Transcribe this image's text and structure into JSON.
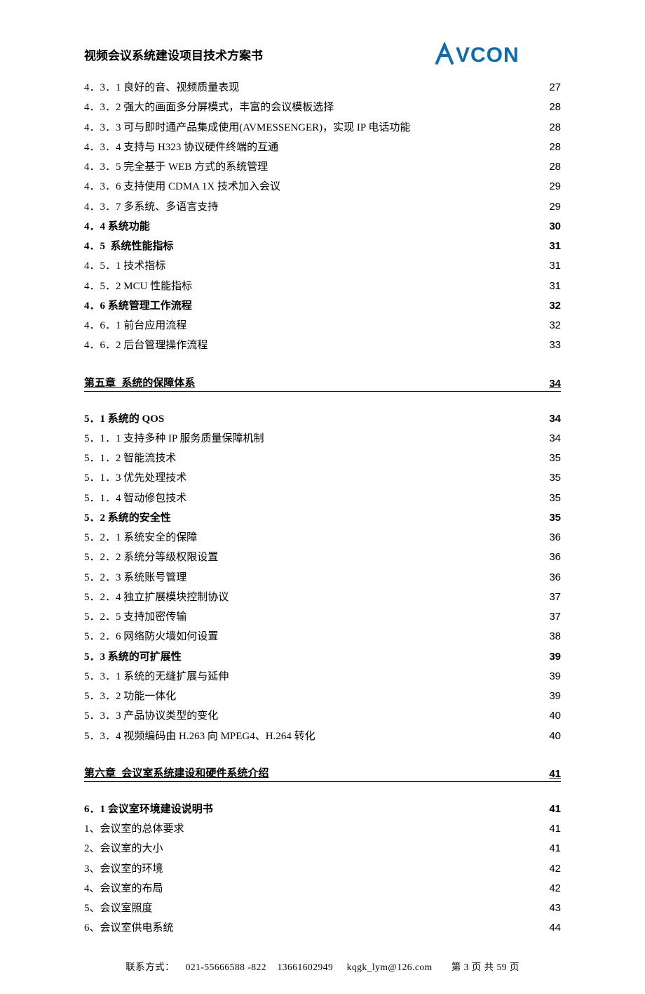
{
  "header": {
    "title": "视频会议系统建设项目技术方案书",
    "logo_text": "AVCON",
    "logo_color": "#0a6cb3"
  },
  "toc": [
    {
      "label": "4．3．1 良好的音、视频质量表现",
      "page": "27",
      "bold": false
    },
    {
      "label": "4．3．2 强大的画面多分屏模式，丰富的会议模板选择",
      "page": "28",
      "bold": false
    },
    {
      "label": "4．3．3 可与即时通产品集成使用(AVMESSENGER)，实现 IP 电话功能",
      "page": "28",
      "bold": false
    },
    {
      "label": "4．3．4 支持与 H323 协议硬件终端的互通",
      "page": "28",
      "bold": false
    },
    {
      "label": "4．3．5 完全基于 WEB 方式的系统管理",
      "page": "28",
      "bold": false
    },
    {
      "label": "4．3．6 支持使用 CDMA 1X 技术加入会议",
      "page": "29",
      "bold": false
    },
    {
      "label": "4．3．7 多系统、多语言支持",
      "page": "29",
      "bold": false
    },
    {
      "label": "4．4 系统功能",
      "page": "30",
      "bold": true
    },
    {
      "label": "4．5  系统性能指标",
      "page": "31",
      "bold": true
    },
    {
      "label": "4．5．1 技术指标",
      "page": "31",
      "bold": false
    },
    {
      "label": "4．5．2 MCU 性能指标",
      "page": "31",
      "bold": false
    },
    {
      "label": "4．6 系统管理工作流程",
      "page": "32",
      "bold": true
    },
    {
      "label": "4．6．1 前台应用流程",
      "page": "32",
      "bold": false
    },
    {
      "label": "4．6．2 后台管理操作流程",
      "page": "33",
      "bold": false
    }
  ],
  "chapter5": {
    "label": "第五章  系统的保障体系",
    "page": "34"
  },
  "toc2": [
    {
      "label": "5．1 系统的 QOS",
      "page": "34",
      "bold": true
    },
    {
      "label": "5．1．1 支持多种 IP 服务质量保障机制",
      "page": "34",
      "bold": false
    },
    {
      "label": "5．1．2 智能流技术",
      "page": "35",
      "bold": false
    },
    {
      "label": "5．1．3 优先处理技术",
      "page": "35",
      "bold": false
    },
    {
      "label": "5．1．4 智动修包技术",
      "page": "35",
      "bold": false
    },
    {
      "label": "5．2 系统的安全性",
      "page": "35",
      "bold": true
    },
    {
      "label": "5．2．1 系统安全的保障",
      "page": "36",
      "bold": false
    },
    {
      "label": "5．2．2 系统分等级权限设置",
      "page": "36",
      "bold": false
    },
    {
      "label": "5．2．3 系统账号管理",
      "page": "36",
      "bold": false
    },
    {
      "label": "5．2．4 独立扩展模块控制协议",
      "page": "37",
      "bold": false
    },
    {
      "label": "5．2．5 支持加密传输",
      "page": "37",
      "bold": false
    },
    {
      "label": "5．2．6 网络防火墙如何设置",
      "page": "38",
      "bold": false
    },
    {
      "label": "5．3 系统的可扩展性",
      "page": "39",
      "bold": true
    },
    {
      "label": "5．3．1 系统的无缝扩展与延伸",
      "page": "39",
      "bold": false
    },
    {
      "label": "5．3．2 功能一体化",
      "page": "39",
      "bold": false
    },
    {
      "label": "5．3．3 产品协议类型的变化",
      "page": "40",
      "bold": false
    },
    {
      "label": "5．3．4 视频编码由 H.263 向 MPEG4、H.264 转化",
      "page": "40",
      "bold": false
    }
  ],
  "chapter6": {
    "label": "第六章  会议室系统建设和硬件系统介绍",
    "page": "41"
  },
  "toc3": [
    {
      "label": "6．1 会议室环境建设说明书",
      "page": "41",
      "bold": true
    },
    {
      "label": "1、会议室的总体要求",
      "page": "41",
      "bold": false
    },
    {
      "label": "2、会议室的大小",
      "page": "41",
      "bold": false
    },
    {
      "label": "3、会议室的环境",
      "page": "42",
      "bold": false
    },
    {
      "label": "4、会议室的布局",
      "page": "42",
      "bold": false
    },
    {
      "label": "5、会议室照度",
      "page": "43",
      "bold": false
    },
    {
      "label": "6、会议室供电系统",
      "page": "44",
      "bold": false
    }
  ],
  "footer": {
    "contact_label": "联系方式：",
    "phone1": "021-55666588 -822",
    "phone2": "13661602949",
    "email": "kqgk_lym@126.com",
    "page_info": "第 3 页 共 59 页"
  }
}
